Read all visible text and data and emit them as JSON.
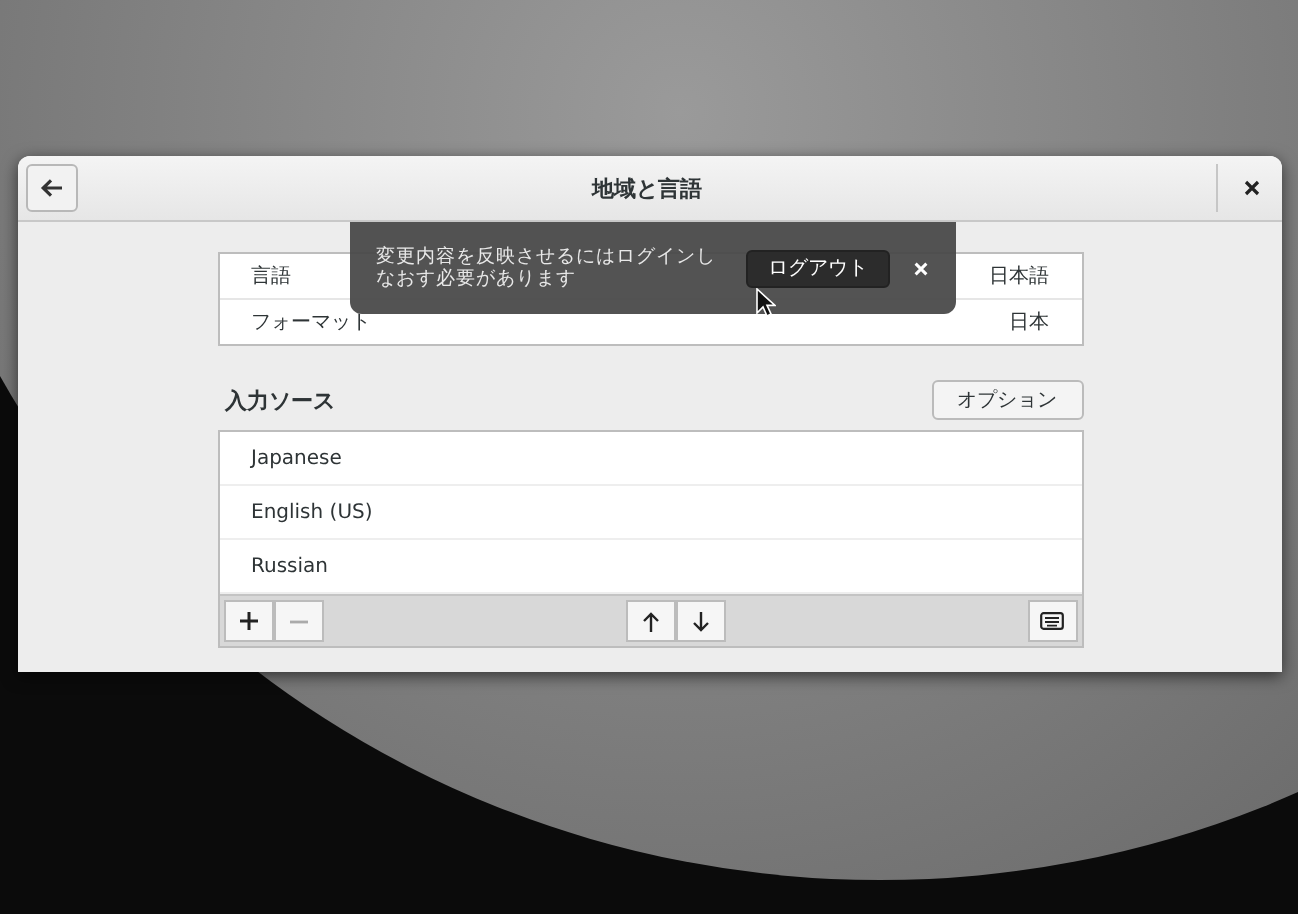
{
  "window": {
    "title": "地域と言語"
  },
  "settings": [
    {
      "label": "言語",
      "value": "日本語"
    },
    {
      "label": "フォーマット",
      "value": "日本"
    }
  ],
  "notification": {
    "message": "変更内容を反映させるにはログインしなおす必要があります",
    "button": "ログアウト"
  },
  "input_sources": {
    "heading": "入力ソース",
    "options_button": "オプション",
    "items": [
      {
        "name": "Japanese"
      },
      {
        "name": "English (US)"
      },
      {
        "name": "Russian"
      }
    ],
    "toolbar": [
      {
        "kind": "add",
        "disabled": false
      },
      {
        "kind": "remove",
        "disabled": true
      },
      {
        "kind": "up",
        "disabled": false
      },
      {
        "kind": "down",
        "disabled": false
      },
      {
        "kind": "keyboard",
        "disabled": false
      }
    ]
  }
}
